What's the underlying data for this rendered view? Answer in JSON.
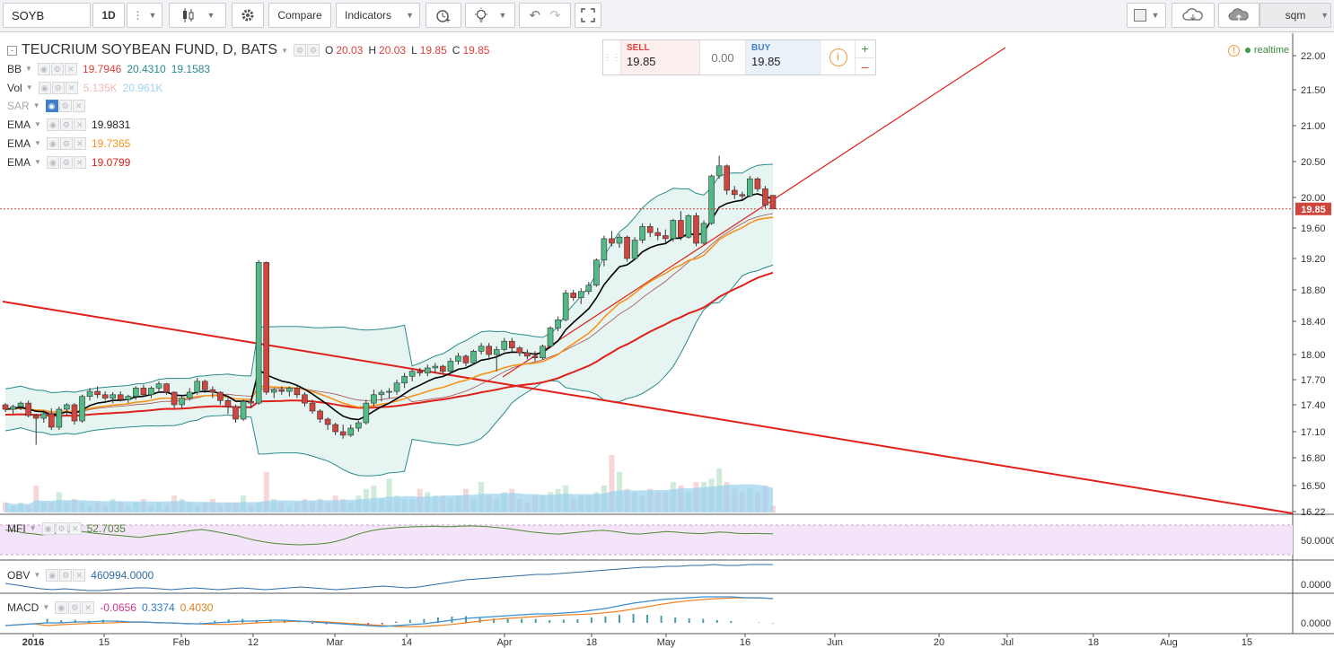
{
  "toolbar": {
    "symbol": "SOYB",
    "interval": "1D",
    "compare_label": "Compare",
    "indicators_label": "Indicators",
    "layout_label": "sqm"
  },
  "header": {
    "title": "TEUCRIUM SOYBEAN FUND, D, BATS",
    "ohlc": {
      "o_label": "O",
      "o": "20.03",
      "h_label": "H",
      "h": "20.03",
      "l_label": "L",
      "l": "19.85",
      "c_label": "C",
      "c": "19.85"
    }
  },
  "legend": {
    "bb": {
      "name": "BB",
      "v1": "19.7946",
      "v2": "20.4310",
      "v3": "19.1583"
    },
    "vol": {
      "name": "Vol",
      "v1": "5.135K",
      "v2": "20.961K"
    },
    "sar": {
      "name": "SAR"
    },
    "ema1": {
      "name": "EMA",
      "v": "19.9831"
    },
    "ema2": {
      "name": "EMA",
      "v": "19.7365"
    },
    "ema3": {
      "name": "EMA",
      "v": "19.0799"
    },
    "mfi": {
      "name": "MFI",
      "v": "52.7035"
    },
    "obv": {
      "name": "OBV",
      "v": "460994.0000"
    },
    "macd": {
      "name": "MACD",
      "v1": "-0.0656",
      "v2": "0.3374",
      "v3": "0.4030"
    }
  },
  "trade": {
    "sell_label": "SELL",
    "sell_price": "19.85",
    "spread": "0.00",
    "buy_label": "BUY",
    "buy_price": "19.85"
  },
  "status": {
    "realtime": "realtime"
  },
  "colors": {
    "up": "#53b987",
    "down": "#eb4d5c",
    "bb_fill": "#e6f4f2",
    "bb_line": "#2a8a8c",
    "ema_fast": "#000000",
    "ema_mid": "#f7931a",
    "ema_slow": "#e0201a",
    "trend": "#e0201a",
    "mfi_bg": "#f3e4fa",
    "mfi_line": "#4e8a2e",
    "obv_line": "#2e6da4",
    "macd_line": "#3a8fd0",
    "signal_line": "#f08020"
  },
  "chart_data": {
    "type": "candlestick",
    "title": "TEUCRIUM SOYBEAN FUND, D, BATS",
    "price_axis": {
      "ticks": [
        "22.00",
        "21.50",
        "21.00",
        "20.50",
        "20.00",
        "19.60",
        "19.20",
        "18.80",
        "18.40",
        "18.00",
        "17.70",
        "17.40",
        "17.10",
        "16.80",
        "16.50",
        "16.22"
      ],
      "last_price": "19.85"
    },
    "time_axis": {
      "ticks": [
        "2016",
        "15",
        "Feb",
        "12",
        "Mar",
        "14",
        "Apr",
        "18",
        "May",
        "16",
        "Jun",
        "20",
        "Jul",
        "18",
        "Aug",
        "15"
      ]
    },
    "candles_ohlc": [
      [
        17.4,
        17.42,
        17.32,
        17.35
      ],
      [
        17.35,
        17.4,
        17.3,
        17.38
      ],
      [
        17.38,
        17.44,
        17.34,
        17.42
      ],
      [
        17.42,
        17.45,
        17.26,
        17.28
      ],
      [
        17.28,
        17.3,
        16.95,
        17.25
      ],
      [
        17.25,
        17.34,
        17.2,
        17.3
      ],
      [
        17.3,
        17.36,
        17.12,
        17.15
      ],
      [
        17.15,
        17.38,
        17.12,
        17.35
      ],
      [
        17.35,
        17.42,
        17.28,
        17.4
      ],
      [
        17.4,
        17.42,
        17.18,
        17.22
      ],
      [
        17.22,
        17.52,
        17.2,
        17.5
      ],
      [
        17.5,
        17.6,
        17.45,
        17.56
      ],
      [
        17.56,
        17.62,
        17.48,
        17.52
      ],
      [
        17.52,
        17.56,
        17.45,
        17.48
      ],
      [
        17.48,
        17.55,
        17.42,
        17.52
      ],
      [
        17.52,
        17.56,
        17.44,
        17.46
      ],
      [
        17.46,
        17.52,
        17.42,
        17.5
      ],
      [
        17.5,
        17.62,
        17.46,
        17.6
      ],
      [
        17.6,
        17.64,
        17.5,
        17.52
      ],
      [
        17.52,
        17.62,
        17.48,
        17.6
      ],
      [
        17.6,
        17.68,
        17.55,
        17.65
      ],
      [
        17.65,
        17.66,
        17.52,
        17.55
      ],
      [
        17.55,
        17.56,
        17.36,
        17.4
      ],
      [
        17.4,
        17.52,
        17.36,
        17.48
      ],
      [
        17.48,
        17.6,
        17.45,
        17.55
      ],
      [
        17.55,
        17.72,
        17.52,
        17.68
      ],
      [
        17.68,
        17.7,
        17.54,
        17.58
      ],
      [
        17.58,
        17.62,
        17.48,
        17.55
      ],
      [
        17.55,
        17.56,
        17.4,
        17.45
      ],
      [
        17.45,
        17.48,
        17.3,
        17.38
      ],
      [
        17.38,
        17.4,
        17.2,
        17.24
      ],
      [
        17.24,
        17.46,
        17.22,
        17.44
      ],
      [
        17.44,
        17.46,
        17.36,
        17.42
      ],
      [
        17.42,
        19.18,
        17.4,
        19.15
      ],
      [
        19.15,
        19.16,
        17.52,
        17.55
      ],
      [
        17.55,
        17.6,
        17.48,
        17.58
      ],
      [
        17.58,
        17.62,
        17.52,
        17.56
      ],
      [
        17.56,
        17.62,
        17.5,
        17.6
      ],
      [
        17.6,
        17.62,
        17.48,
        17.52
      ],
      [
        17.52,
        17.55,
        17.38,
        17.42
      ],
      [
        17.42,
        17.46,
        17.3,
        17.33
      ],
      [
        17.33,
        17.35,
        17.2,
        17.24
      ],
      [
        17.24,
        17.26,
        17.12,
        17.18
      ],
      [
        17.18,
        17.2,
        17.06,
        17.1
      ],
      [
        17.1,
        17.18,
        17.02,
        17.06
      ],
      [
        17.06,
        17.18,
        17.04,
        17.14
      ],
      [
        17.14,
        17.22,
        17.1,
        17.2
      ],
      [
        17.2,
        17.46,
        17.18,
        17.42
      ],
      [
        17.42,
        17.58,
        17.38,
        17.52
      ],
      [
        17.52,
        17.58,
        17.44,
        17.55
      ],
      [
        17.55,
        17.6,
        17.48,
        17.56
      ],
      [
        17.56,
        17.7,
        17.52,
        17.66
      ],
      [
        17.66,
        17.78,
        17.6,
        17.74
      ],
      [
        17.74,
        17.82,
        17.68,
        17.8
      ],
      [
        17.8,
        17.84,
        17.74,
        17.78
      ],
      [
        17.78,
        17.88,
        17.74,
        17.84
      ],
      [
        17.84,
        17.9,
        17.78,
        17.86
      ],
      [
        17.86,
        17.88,
        17.76,
        17.8
      ],
      [
        17.8,
        17.96,
        17.78,
        17.92
      ],
      [
        17.92,
        18.02,
        17.88,
        17.98
      ],
      [
        17.98,
        18.0,
        17.86,
        17.9
      ],
      [
        17.9,
        18.06,
        17.88,
        18.04
      ],
      [
        18.04,
        18.14,
        18.0,
        18.1
      ],
      [
        18.1,
        18.14,
        17.96,
        18.0
      ],
      [
        18.0,
        18.1,
        17.8,
        18.06
      ],
      [
        18.06,
        18.2,
        18.04,
        18.16
      ],
      [
        18.16,
        18.2,
        18.04,
        18.08
      ],
      [
        18.08,
        18.1,
        17.98,
        18.02
      ],
      [
        18.02,
        18.06,
        17.94,
        17.98
      ],
      [
        17.98,
        18.04,
        17.92,
        17.96
      ],
      [
        17.96,
        18.12,
        17.94,
        18.1
      ],
      [
        18.1,
        18.34,
        18.08,
        18.32
      ],
      [
        18.32,
        18.46,
        18.28,
        18.42
      ],
      [
        18.42,
        18.8,
        18.4,
        18.76
      ],
      [
        18.76,
        18.8,
        18.66,
        18.7
      ],
      [
        18.7,
        18.82,
        18.62,
        18.78
      ],
      [
        18.78,
        18.9,
        18.74,
        18.86
      ],
      [
        18.86,
        19.2,
        18.84,
        19.18
      ],
      [
        19.18,
        19.5,
        19.1,
        19.46
      ],
      [
        19.46,
        19.56,
        19.36,
        19.4
      ],
      [
        19.4,
        19.52,
        19.34,
        19.48
      ],
      [
        19.48,
        19.5,
        19.16,
        19.2
      ],
      [
        19.2,
        19.48,
        19.18,
        19.44
      ],
      [
        19.44,
        19.66,
        19.4,
        19.62
      ],
      [
        19.62,
        19.66,
        19.48,
        19.54
      ],
      [
        19.54,
        19.6,
        19.44,
        19.5
      ],
      [
        19.5,
        19.58,
        19.4,
        19.46
      ],
      [
        19.46,
        19.72,
        19.42,
        19.7
      ],
      [
        19.7,
        19.82,
        19.44,
        19.48
      ],
      [
        19.48,
        19.78,
        19.46,
        19.76
      ],
      [
        19.76,
        19.8,
        19.36,
        19.4
      ],
      [
        19.4,
        19.7,
        19.38,
        19.66
      ],
      [
        19.66,
        20.32,
        19.64,
        20.3
      ],
      [
        20.3,
        20.58,
        20.26,
        20.44
      ],
      [
        20.44,
        20.46,
        20.04,
        20.1
      ],
      [
        20.1,
        20.16,
        19.98,
        20.04
      ],
      [
        20.04,
        20.08,
        19.98,
        20.02
      ],
      [
        20.02,
        20.3,
        20.0,
        20.26
      ],
      [
        20.26,
        20.28,
        20.08,
        20.12
      ],
      [
        20.12,
        20.16,
        19.86,
        19.9
      ],
      [
        20.03,
        20.03,
        19.85,
        19.85
      ]
    ],
    "volume": [
      3,
      2,
      3,
      2,
      8,
      3,
      3,
      6,
      3,
      4,
      3,
      2,
      3,
      2,
      4,
      3,
      2,
      3,
      4,
      2,
      3,
      2,
      5,
      4,
      3,
      2,
      3,
      4,
      2,
      3,
      3,
      5,
      2,
      3,
      12,
      4,
      3,
      2,
      3,
      4,
      3,
      4,
      3,
      5,
      4,
      3,
      5,
      7,
      8,
      4,
      10,
      5,
      4,
      4,
      7,
      6,
      5,
      5,
      4,
      5,
      7,
      4,
      9,
      5,
      4,
      6,
      7,
      4,
      3,
      5,
      5,
      6,
      7,
      8,
      4,
      5,
      5,
      6,
      8,
      17,
      12,
      7,
      6,
      5,
      7,
      6,
      6,
      9,
      8,
      6,
      9,
      9,
      10,
      13,
      9,
      7,
      6,
      7,
      6,
      8,
      2
    ],
    "mfi": {
      "last": 52.7035,
      "ticks": [
        "50.0000"
      ]
    },
    "obv": {
      "last": 460994.0,
      "ticks": [
        "0.0000"
      ]
    },
    "macd": {
      "histogram": -0.0656,
      "macd": 0.3374,
      "signal": 0.403,
      "ticks": [
        "0.0000"
      ]
    }
  }
}
